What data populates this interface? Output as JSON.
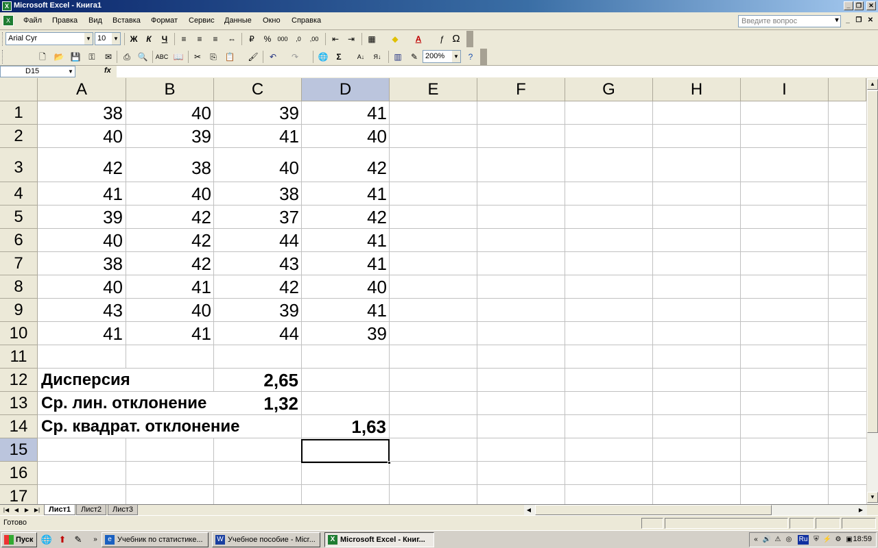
{
  "window": {
    "title": "Microsoft Excel - Книга1"
  },
  "menu": {
    "items": [
      "Файл",
      "Правка",
      "Вид",
      "Вставка",
      "Формат",
      "Сервис",
      "Данные",
      "Окно",
      "Справка"
    ],
    "help_placeholder": "Введите вопрос"
  },
  "format_toolbar": {
    "font": "Arial Cyr",
    "size": "10",
    "bold": "Ж",
    "italic": "К",
    "underline": "Ч",
    "percent": "%",
    "thousands": "000",
    "omega": "Ω"
  },
  "standard_toolbar": {
    "zoom": "200%",
    "sum": "Σ"
  },
  "formula_bar": {
    "name_box": "D15",
    "fx": "fx",
    "formula": ""
  },
  "sheet": {
    "columns": [
      "A",
      "B",
      "C",
      "D",
      "E",
      "F",
      "G",
      "H",
      "I"
    ],
    "rows": [
      "1",
      "2",
      "3",
      "4",
      "5",
      "6",
      "7",
      "8",
      "9",
      "10",
      "11",
      "12",
      "13",
      "14",
      "15",
      "16",
      "17"
    ],
    "data": [
      [
        "38",
        "40",
        "39",
        "41"
      ],
      [
        "40",
        "39",
        "41",
        "40"
      ],
      [
        "42",
        "38",
        "40",
        "42"
      ],
      [
        "41",
        "40",
        "38",
        "41"
      ],
      [
        "39",
        "42",
        "37",
        "42"
      ],
      [
        "40",
        "42",
        "44",
        "41"
      ],
      [
        "38",
        "42",
        "43",
        "41"
      ],
      [
        "40",
        "41",
        "42",
        "40"
      ],
      [
        "43",
        "40",
        "39",
        "41"
      ],
      [
        "41",
        "41",
        "44",
        "39"
      ]
    ],
    "stats": [
      {
        "label": "Дисперсия",
        "value": "2,65"
      },
      {
        "label": "Ср. лин. отклонение",
        "value": "1,32"
      },
      {
        "label": "Ср. квадрат. отклонение",
        "value": "1,63"
      }
    ],
    "active_cell": "D15",
    "tabs": [
      "Лист1",
      "Лист2",
      "Лист3"
    ]
  },
  "status": {
    "text": "Готово"
  },
  "taskbar": {
    "start": "Пуск",
    "tasks": [
      "Учебник по статистике...",
      "Учебное пособие - Micr...",
      "Microsoft Excel - Книг..."
    ],
    "lang": "Ru",
    "clock": "18:59"
  }
}
